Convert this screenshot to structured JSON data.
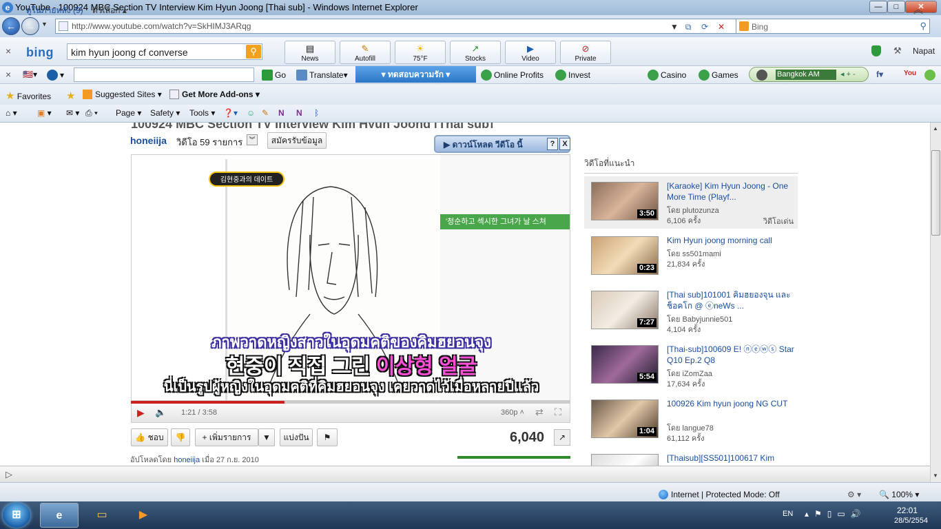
{
  "window": {
    "title": "YouTube - 100924 MBC Section TV Interview Kim Hyun Joong [Thai sub] - Windows Internet Explorer",
    "minimize": "—",
    "maximize": "□",
    "close": "✕"
  },
  "address_bar": {
    "url": "http://www.youtube.com/watch?v=SkHIMJ3ARqg",
    "search_placeholder": "Bing"
  },
  "bing_toolbar": {
    "close": "×",
    "logo": "bing",
    "query": "kim hyun joong cf converse",
    "buttons": [
      {
        "icon": "news-icon",
        "label": "News",
        "glyph": "▤"
      },
      {
        "icon": "autofill-icon",
        "label": "Autofill",
        "glyph": "✎"
      },
      {
        "icon": "weather-icon",
        "label": "75°F",
        "glyph": "☀"
      },
      {
        "icon": "stocks-icon",
        "label": "Stocks",
        "glyph": "↗"
      },
      {
        "icon": "video-icon",
        "label": "Video",
        "glyph": "▶"
      },
      {
        "icon": "private-icon",
        "label": "Private",
        "glyph": "⊘"
      }
    ],
    "user": "Napat"
  },
  "toolbar3": {
    "close": "×",
    "go": "Go",
    "translate": "Translate",
    "thai_button": "▾ ทดสอบความรัก ▾",
    "online_profits": "Online Profits",
    "invest": "Invest",
    "casino": "Casino",
    "games": "Games",
    "radio_station": "Bangkok AM"
  },
  "favorites_bar": {
    "favorites": "Favorites",
    "suggested": "Suggested Sites",
    "addons": "Get More Add-ons"
  },
  "command_bar": {
    "page": "Page",
    "safety": "Safety",
    "tools": "Tools"
  },
  "video_page": {
    "title_cut": "100924 MBC Section TV Interview Kim Hyun Joong [Thai sub]",
    "channel": "honeiija",
    "video_count": "วิดีโอ 59 รายการ",
    "subscribe": "สมัครรับข้อมูล",
    "download_banner": "ดาวน์โหลด วีดีโอ นี้",
    "download_help": "?",
    "download_close": "X",
    "badge_text": "김현중과의 데이트",
    "article_heading": "'청순하고 섹시한 그녀가 날 스쳐",
    "subtitle_thai_top": "ภาพวาดหญิงสาวในอุดมคติของคิมฮยอนจุง",
    "subtitle_korean_white": "현중이 직접 그린 ",
    "subtitle_korean_pink": "이상형 얼굴",
    "subtitle_thai_bottom": "นี่เป็นรูปผู้หญิงในอุดมคติที่คิมฮยอนจุง เคยวาดไว้เมื่อหลายปีแล้ว",
    "progress": 0.35,
    "time": "1:21 / 3:58",
    "quality": "360p",
    "like": "ชอบ",
    "add_to": "เพิ่มรายการ",
    "share": "แบ่งปัน",
    "views": "6,040",
    "uploaded_prefix": "อัปโหลดโดย",
    "uploader": "honeiija",
    "uploaded_date": "เมื่อ 27 ก.ย. 2010"
  },
  "related": {
    "heading": "วิดีโอที่แนะนำ",
    "featured_label": "วิดีโอเด่น",
    "items": [
      {
        "title": "[Karaoke] Kim Hyun Joong - One More Time (Playf...",
        "by": "โดย plutozunza",
        "views": "6,106 ครั้ง",
        "duration": "3:50"
      },
      {
        "title": "Kim Hyun joong morning call",
        "by": "โดย ss501mami",
        "views": "21,834 ครั้ง",
        "duration": "0:23"
      },
      {
        "title": "[Thai sub]101001 คิมฮยองจุน และ ช็อคโก @ ⓔneWs ...",
        "by": "โดย Babyjunnie501",
        "views": "4,104 ครั้ง",
        "duration": "7:27"
      },
      {
        "title": "[Thai-sub]100609 E! ⓝⓔⓦⓢ Star Q10 Ep.2 Q8",
        "by": "โดย iZomZaa",
        "views": "17,634 ครั้ง",
        "duration": "5:54"
      },
      {
        "title": "100926 Kim hyun joong NG CUT",
        "by": "โดย langue78",
        "views": "61,112 ครั้ง",
        "duration": "1:04"
      },
      {
        "title": "[Thaisub][SS501]100617 Kim",
        "by": "",
        "views": "",
        "duration": ""
      }
    ]
  },
  "watch_later": {
    "label": "ดูในภายหลัง (9)",
    "options": "ตัวเลือก"
  },
  "status_bar": {
    "zone": "Internet | Protected Mode: Off",
    "zoom": "100%"
  },
  "taskbar": {
    "lang": "EN",
    "time": "22:01",
    "date": "28/5/2554"
  }
}
